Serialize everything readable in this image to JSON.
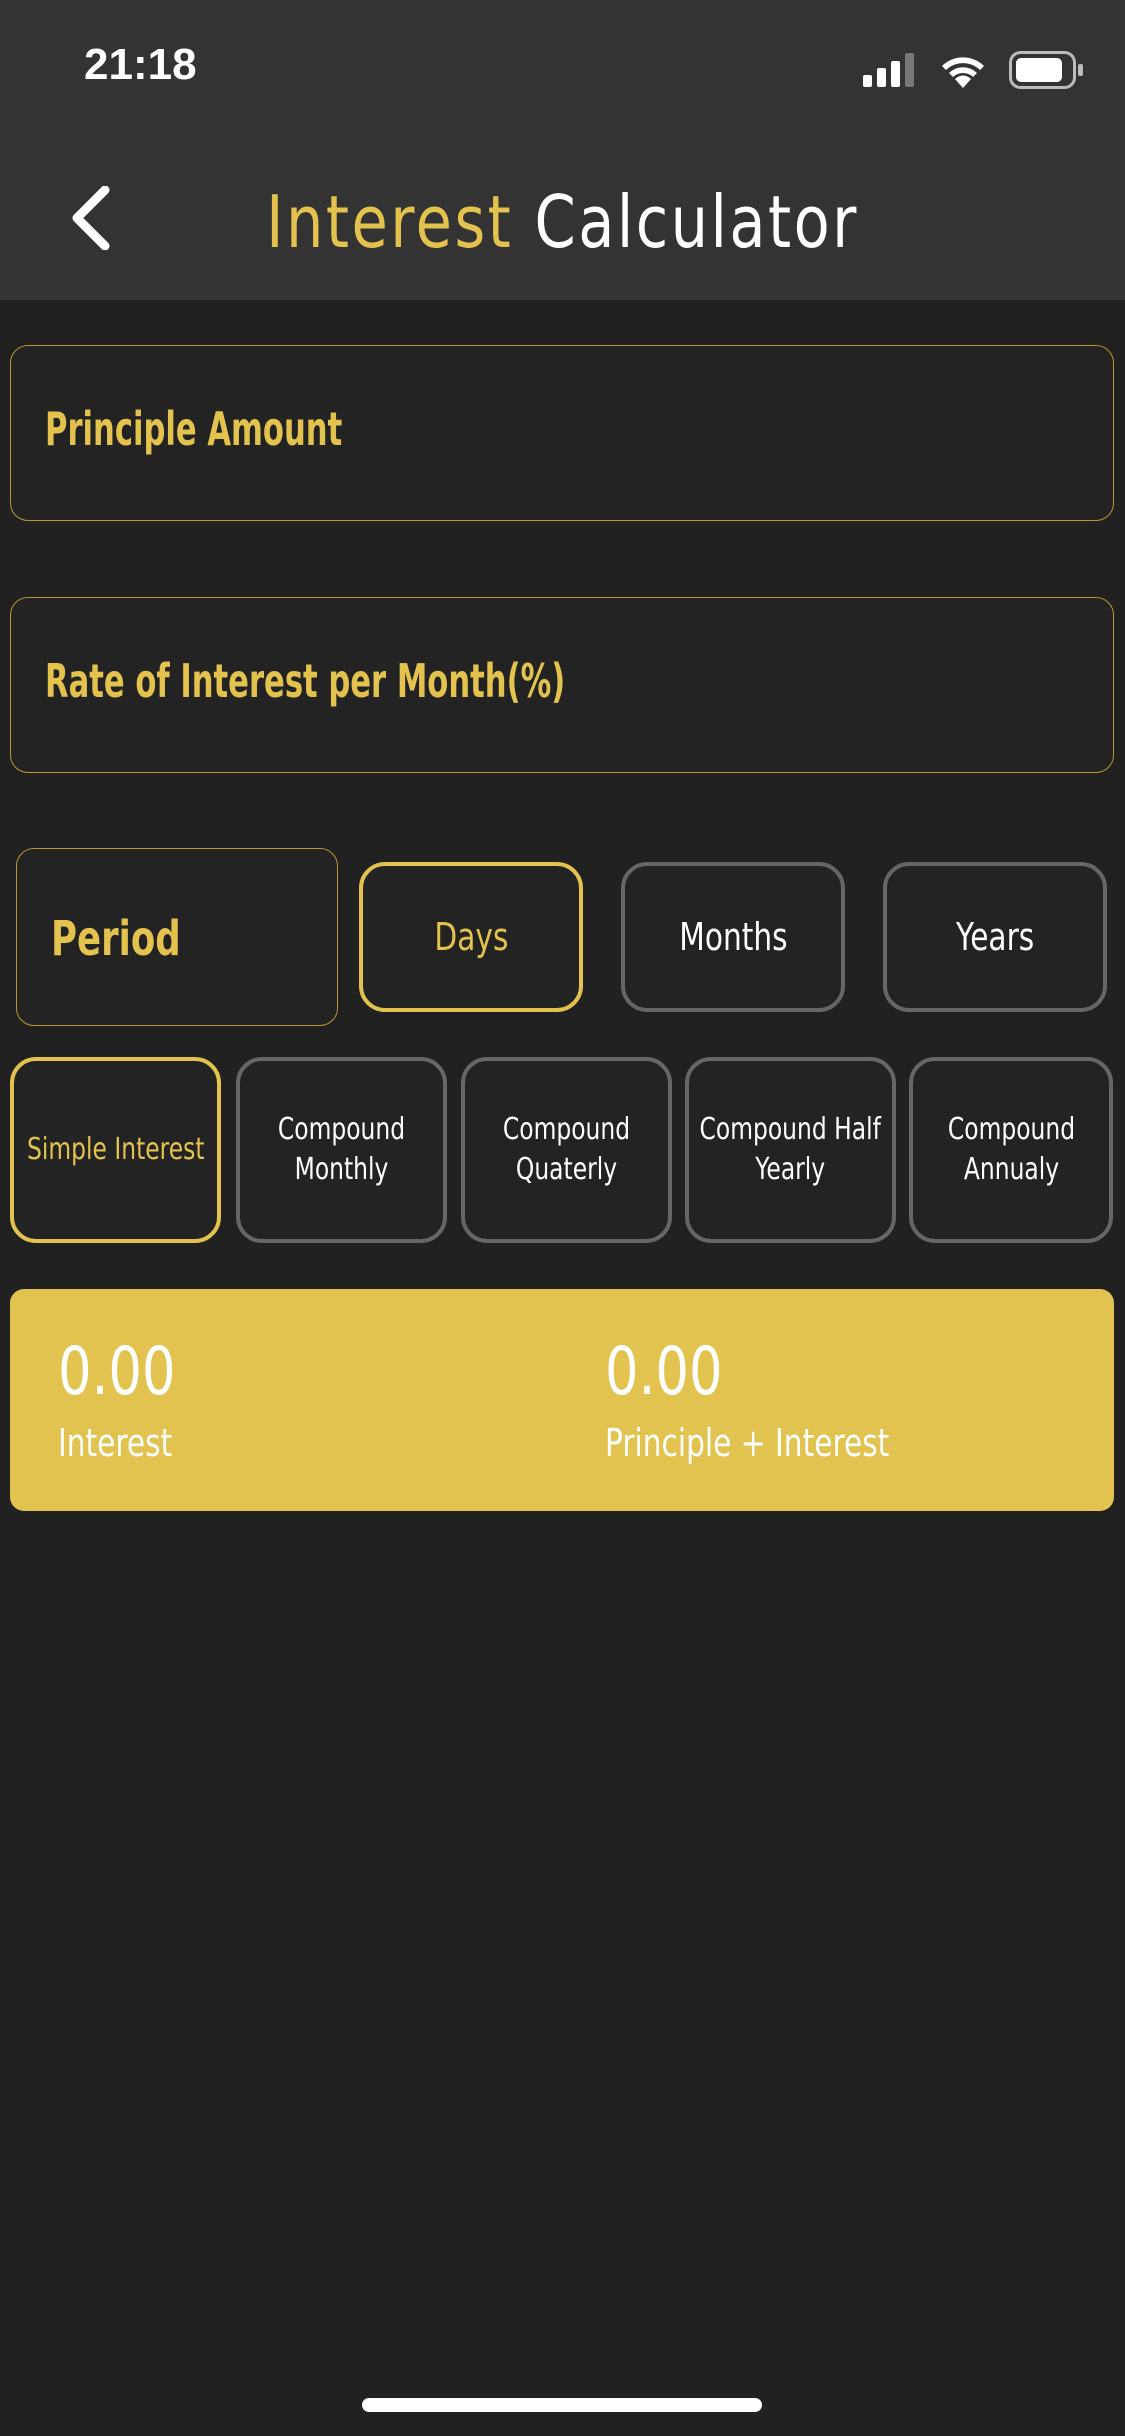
{
  "status_bar": {
    "time": "21:18"
  },
  "header": {
    "title_part1": "Interest",
    "title_part2": "Calculator"
  },
  "fields": {
    "principle_label": "Principle Amount",
    "rate_label": "Rate of Interest per Month(%)"
  },
  "period": {
    "label": "Period",
    "options": [
      "Days",
      "Months",
      "Years"
    ],
    "selected": "Days"
  },
  "interest_types": {
    "options": [
      [
        "Simple Interest"
      ],
      [
        "Compound",
        "Monthly"
      ],
      [
        "Compound",
        "Quaterly"
      ],
      [
        "Compound Half",
        "Yearly"
      ],
      [
        "Compound",
        "Annualy"
      ]
    ],
    "selected": "Simple Interest"
  },
  "result": {
    "interest_value": "0.00",
    "interest_label": "Interest",
    "total_value": "0.00",
    "total_label": "Principle + Interest"
  },
  "colors": {
    "accent": "#e3c34e",
    "background": "#212121",
    "bar": "#333333",
    "card": "#e2c34f"
  },
  "icons": [
    "back-chevron-icon",
    "cellular-signal-icon",
    "wifi-icon",
    "battery-icon"
  ]
}
